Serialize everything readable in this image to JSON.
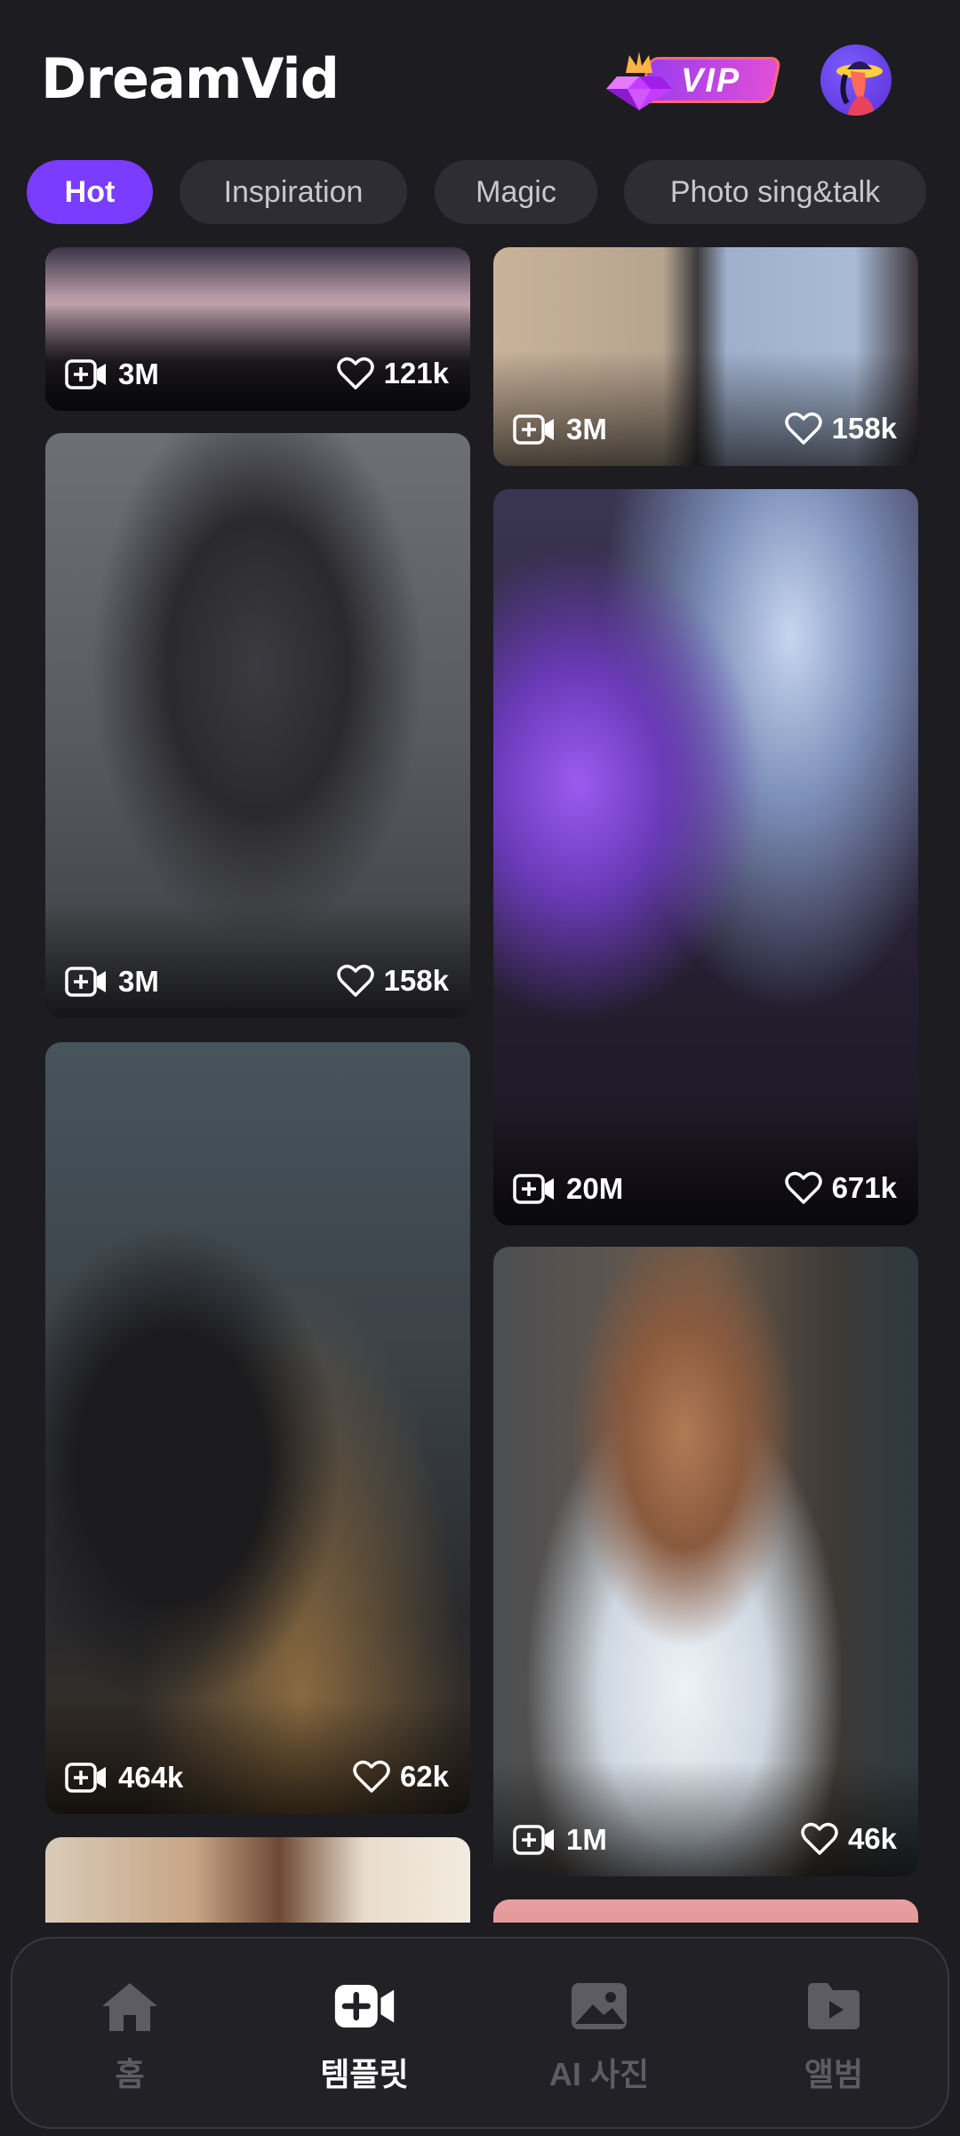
{
  "app": {
    "title": "DreamVid",
    "vip_label": "VIP"
  },
  "tabs": [
    {
      "label": "Hot",
      "active": true
    },
    {
      "label": "Inspiration",
      "active": false
    },
    {
      "label": "Magic",
      "active": false
    },
    {
      "label": "Photo sing&talk",
      "active": false
    }
  ],
  "cards": [
    {
      "uses": "3M",
      "likes": "121k"
    },
    {
      "uses": "3M",
      "likes": "158k"
    },
    {
      "uses": "3M",
      "likes": "158k"
    },
    {
      "uses": "20M",
      "likes": "671k"
    },
    {
      "uses": "464k",
      "likes": "62k"
    },
    {
      "uses": "1M",
      "likes": "46k"
    }
  ],
  "nav": [
    {
      "label": "홈",
      "icon": "home-icon",
      "active": false
    },
    {
      "label": "템플릿",
      "icon": "video-add-icon",
      "active": true
    },
    {
      "label": "AI 사진",
      "icon": "image-icon",
      "active": false
    },
    {
      "label": "앨범",
      "icon": "folder-icon",
      "active": false
    }
  ],
  "colors": {
    "accent": "#7a3cff",
    "background": "#1d1c21",
    "tab_bg": "#2e2d33"
  }
}
